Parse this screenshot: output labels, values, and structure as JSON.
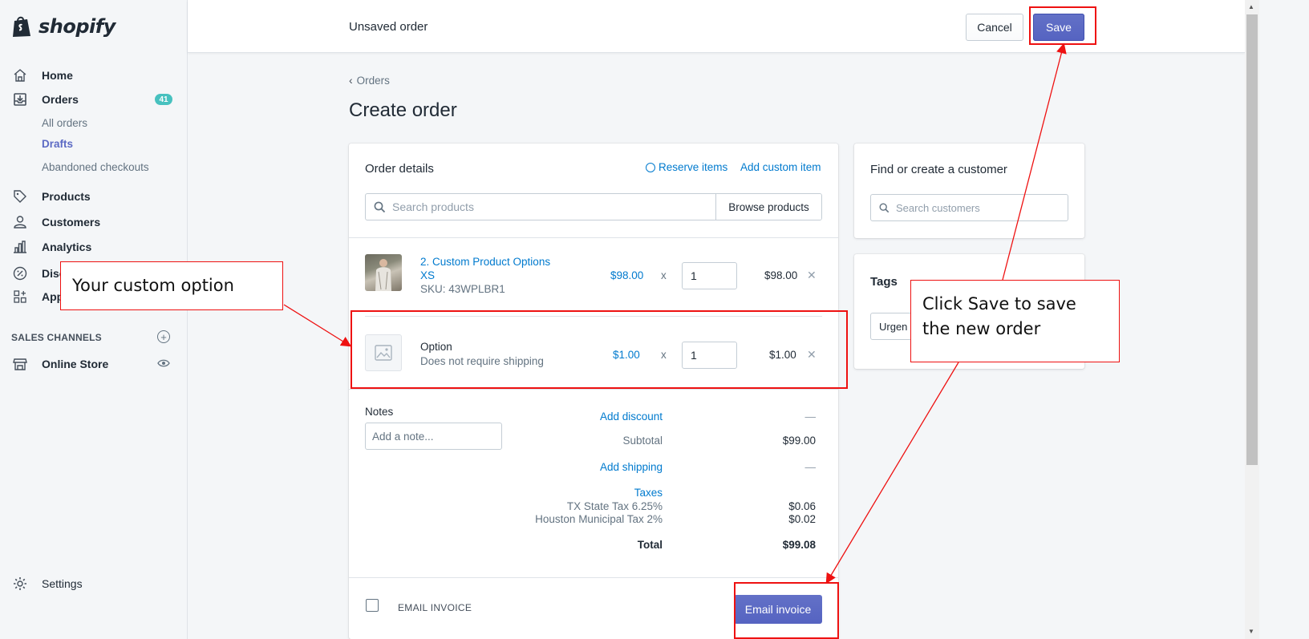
{
  "brand": {
    "name": "shopify",
    "color": "#212b36",
    "logo_color": "#95bf47"
  },
  "topbar": {
    "title": "Unsaved order",
    "cancel_label": "Cancel",
    "save_label": "Save"
  },
  "sidebar": {
    "items": [
      {
        "label": "Home",
        "icon": "home-icon"
      },
      {
        "label": "Orders",
        "icon": "orders-icon",
        "badge": "41"
      },
      {
        "label": "Products",
        "icon": "tag-icon"
      },
      {
        "label": "Customers",
        "icon": "person-icon"
      },
      {
        "label": "Analytics",
        "icon": "chart-icon"
      },
      {
        "label": "Discounts",
        "icon": "discount-icon"
      },
      {
        "label": "Apps",
        "icon": "apps-icon"
      }
    ],
    "order_subitems": [
      "All orders",
      "Drafts",
      "Abandoned checkouts"
    ],
    "active_subitem": "Drafts",
    "sales_channels_label": "SALES CHANNELS",
    "online_store_label": "Online Store",
    "settings_label": "Settings"
  },
  "main": {
    "breadcrumb": "Orders",
    "page_title": "Create order",
    "order_card": {
      "heading": "Order details",
      "reserve_label": "Reserve items",
      "add_custom_label": "Add custom item",
      "search_placeholder": "Search products",
      "browse_label": "Browse products",
      "line_items": [
        {
          "name": "2. Custom Product Options",
          "variant": "XS",
          "sku": "SKU: 43WPLBR1",
          "price": "$98.00",
          "times": "x",
          "qty": "1",
          "total": "$98.00"
        },
        {
          "name": "Option",
          "variant": "Does not require shipping",
          "price": "$1.00",
          "times": "x",
          "qty": "1",
          "total": "$1.00"
        }
      ],
      "notes_label": "Notes",
      "notes_placeholder": "Add a note...",
      "add_discount_label": "Add discount",
      "discount_value": "—",
      "subtotal_label": "Subtotal",
      "subtotal_value": "$99.00",
      "add_shipping_label": "Add shipping",
      "shipping_value": "—",
      "taxes_label": "Taxes",
      "tax_lines": [
        {
          "label": "TX State Tax 6.25%",
          "value": "$0.06"
        },
        {
          "label": "Houston Municipal Tax 2%",
          "value": "$0.02"
        }
      ],
      "total_label": "Total",
      "total_value": "$99.08",
      "email_invoice_section": "EMAIL INVOICE",
      "email_invoice_button": "Email invoice"
    },
    "customer_card": {
      "heading": "Find or create a customer",
      "search_placeholder": "Search customers"
    },
    "tags_card": {
      "heading": "Tags",
      "input_value": "Urgen"
    }
  },
  "annotations": {
    "callout_left": "Your custom option",
    "callout_right": "Click Save to save the new order",
    "color": "#e11111"
  }
}
